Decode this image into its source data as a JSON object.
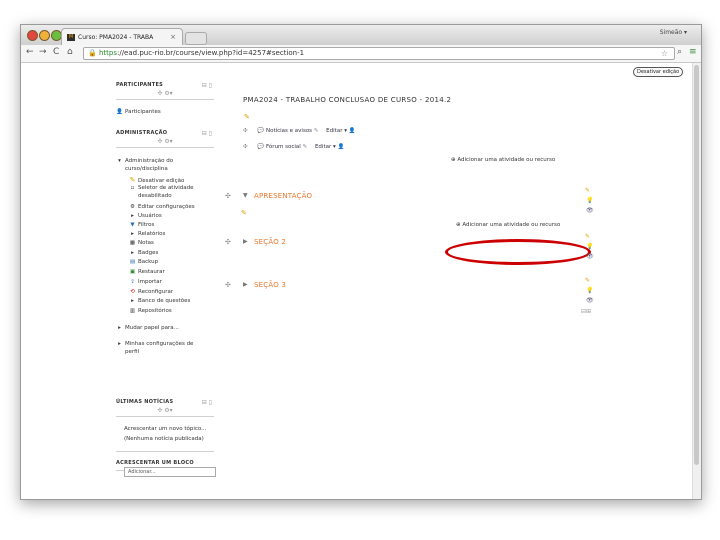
{
  "browser": {
    "tab_title": "Curso: PMA2024 - TRABA",
    "tab_favicon": "M",
    "user": "Simeão",
    "url_https": "https",
    "url_rest": "://ead.puc-rio.br/course/view.php?id=4257#section-1"
  },
  "toolbar": {
    "edit_mode_button": "Desativar edição"
  },
  "sidebar": {
    "participants": {
      "header": "PARTICIPANTES",
      "item": "Participantes"
    },
    "admin": {
      "header": "ADMINISTRAÇÃO",
      "items": [
        {
          "label": "Administração do curso/disciplina",
          "icon": "triangle-down-icon"
        },
        {
          "label": "Desativar edição",
          "icon": "pencil-icon"
        },
        {
          "label": "Seletor de atividade desabilitado",
          "icon": "square-icon"
        },
        {
          "label": "Editar configurações",
          "icon": "settings-icon"
        },
        {
          "label": "Usuários",
          "icon": "triangle-right-icon"
        },
        {
          "label": "Filtros",
          "icon": "filter-icon"
        },
        {
          "label": "Relatórios",
          "icon": "triangle-right-icon"
        },
        {
          "label": "Notas",
          "icon": "grades-icon"
        },
        {
          "label": "Badges",
          "icon": "triangle-right-icon"
        },
        {
          "label": "Backup",
          "icon": "backup-icon"
        },
        {
          "label": "Restaurar",
          "icon": "restore-icon"
        },
        {
          "label": "Importar",
          "icon": "import-icon"
        },
        {
          "label": "Reconfigurar",
          "icon": "reset-icon"
        },
        {
          "label": "Banco de questões",
          "icon": "triangle-right-icon"
        },
        {
          "label": "Repositórios",
          "icon": "repository-icon"
        },
        {
          "label": "Mudar papel para...",
          "icon": "triangle-right-icon"
        },
        {
          "label": "Minhas configurações de perfil",
          "icon": "triangle-right-icon"
        }
      ]
    },
    "news": {
      "header": "ÚLTIMAS NOTÍCIAS",
      "add_topic": "Acrescentar um novo tópico...",
      "none": "(Nenhuma notícia publicada)"
    },
    "add_block": {
      "header": "ACRESCENTAR UM BLOCO",
      "select_value": "Adicionar..."
    }
  },
  "main": {
    "course_title": "PMA2024 - TRABALHO CONCLUSAO DE CURSO - 2014.2",
    "forums": [
      {
        "label": "Notícias e avisos",
        "edit": "Editar"
      },
      {
        "label": "Fórum social",
        "edit": "Editar"
      }
    ],
    "add_activity": "Adicionar uma atividade ou recurso",
    "sections": [
      {
        "title": "APRESENTAÇÃO",
        "add_activity": "Adicionar uma atividade ou recurso"
      },
      {
        "title": "SEÇÃO 2"
      },
      {
        "title": "SEÇÃO 3"
      }
    ]
  },
  "colors": {
    "section_title": "#e8772e",
    "highlight_oval": "#cc0000",
    "link_green": "#2a8a2a"
  }
}
